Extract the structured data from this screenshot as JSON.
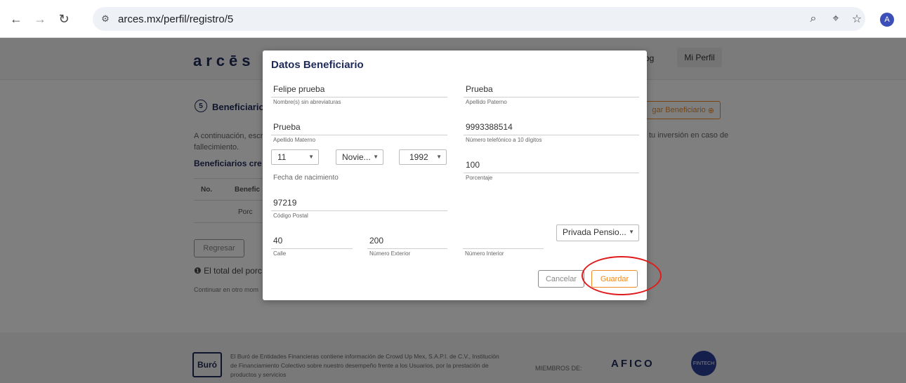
{
  "browser": {
    "url": "arces.mx/perfil/registro/5",
    "avatar_letter": "A"
  },
  "site": {
    "logo": "arcēs",
    "nav_blog": "og",
    "nav_perfil": "Mi Perfil",
    "step_number": "5",
    "step_title": "Beneficiarios",
    "add_button": "gar Beneficiario",
    "intro_left": "A continuación, escr fallecimiento.",
    "intro_right": "tu inversión en caso de",
    "subhead": "Beneficiarios cre",
    "table_headers": [
      "No.",
      "Benefic"
    ],
    "table_row": "Porc",
    "back_button": "Regresar",
    "note": "El total del porc",
    "continue_text": "Continuar en otro mom"
  },
  "footer": {
    "buro_logo": "Buró",
    "text": "El Buró de Entidades Financieras contiene información de Crowd Up Mex, S.A.P.I. de C.V., Institución de Financiamiento Colectivo sobre nuestro desempeño frente a los Usuarios, por la prestación de productos y servicios",
    "members_label": "MIEMBROS DE:",
    "afico": "AFICO",
    "fintech": "FINTECH"
  },
  "modal": {
    "title": "Datos Beneficiario",
    "nombre": {
      "value": "Felipe prueba",
      "label": "Nombre(s) sin abreviaturas"
    },
    "apellido_paterno": {
      "value": "Prueba",
      "label": "Apellido Paterno"
    },
    "apellido_materno": {
      "value": "Prueba",
      "label": "Apellido Materno"
    },
    "telefono": {
      "value": "9993388514",
      "label": "Número telefónico a 10 dígitos"
    },
    "dia": "11",
    "mes": "Novie...",
    "anio": "1992",
    "fecha_label": "Fecha de nacimiento",
    "porcentaje": {
      "value": "100",
      "label": "Porcentaje"
    },
    "codigo_postal": {
      "value": "97219",
      "label": "Código Postal"
    },
    "colonia": "Privada Pensio...",
    "calle": {
      "value": "40",
      "label": "Calle"
    },
    "numero_exterior": {
      "value": "200",
      "label": "Número Exterior"
    },
    "numero_interior": {
      "value": "",
      "label": "Número Interior"
    },
    "cancel_button": "Cancelar",
    "save_button": "Guardar"
  },
  "colors": {
    "brand_navy": "#1f2a5a",
    "accent_orange": "#f08a24",
    "highlight_red": "#e01b1b"
  }
}
